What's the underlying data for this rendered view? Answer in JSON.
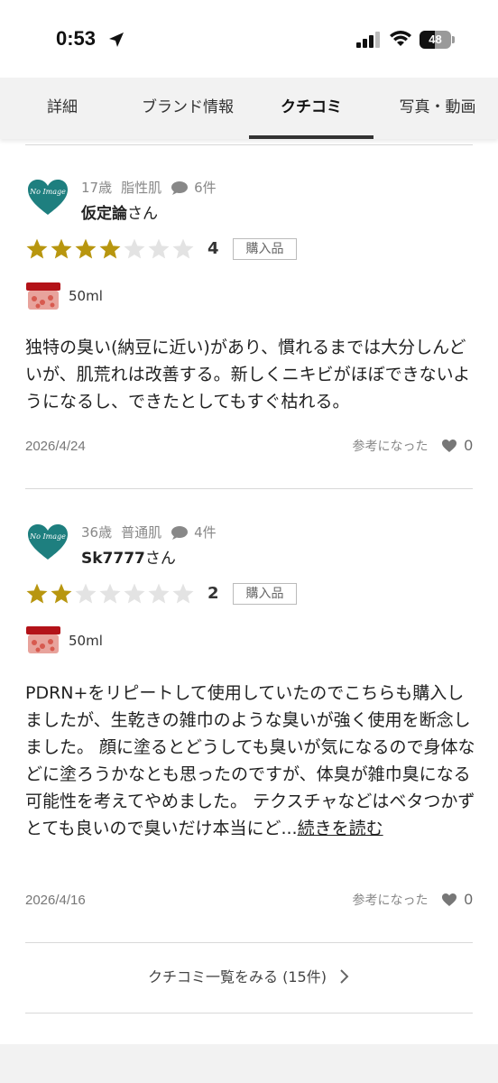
{
  "status": {
    "time": "0:53",
    "battery": "48"
  },
  "tabs": [
    {
      "label": "詳細"
    },
    {
      "label": "ブランド情報"
    },
    {
      "label": "クチコミ"
    },
    {
      "label": "写真・動画"
    }
  ],
  "reviews": [
    {
      "avatar_text": "No Image",
      "age": "17歳",
      "skin": "脂性肌",
      "review_count": "6件",
      "name": "仮定論",
      "honorific": "さん",
      "rating": 4,
      "rating_label": "4",
      "badge": "購入品",
      "volume": "50ml",
      "body": "独特の臭い(納豆に近い)があり、慣れるまでは大分しんどいが、肌荒れは改善する。新しくニキビがほぼできないようになるし、できたとしてもすぐ枯れる。",
      "read_more": "",
      "date": "2026/4/24",
      "helpful_label": "参考になった",
      "helpful_count": "0"
    },
    {
      "avatar_text": "No Image",
      "age": "36歳",
      "skin": "普通肌",
      "review_count": "4件",
      "name": "Sk7777",
      "honorific": "さん",
      "rating": 2,
      "rating_label": "2",
      "badge": "購入品",
      "volume": "50ml",
      "body": "PDRN+をリピートして使用していたのでこちらも購入しましたが、生乾きの雑巾のような臭いが強く使用を断念しました。 顔に塗るとどうしても臭いが気になるので身体などに塗ろうかなとも思ったのですが、体臭が雑巾臭になる可能性を考えてやめました。 テクスチャなどはベタつかずとても良いので臭いだけ本当にど...",
      "read_more": "続きを読む",
      "date": "2026/4/16",
      "helpful_label": "参考になった",
      "helpful_count": "0"
    }
  ],
  "more_link": "クチコミ一覧をみる (15件)",
  "colors": {
    "star_filled": "#b8960f",
    "star_empty": "#e3e3e3",
    "avatar_teal": "#1e7f7f",
    "tab_underline": "#333333"
  }
}
